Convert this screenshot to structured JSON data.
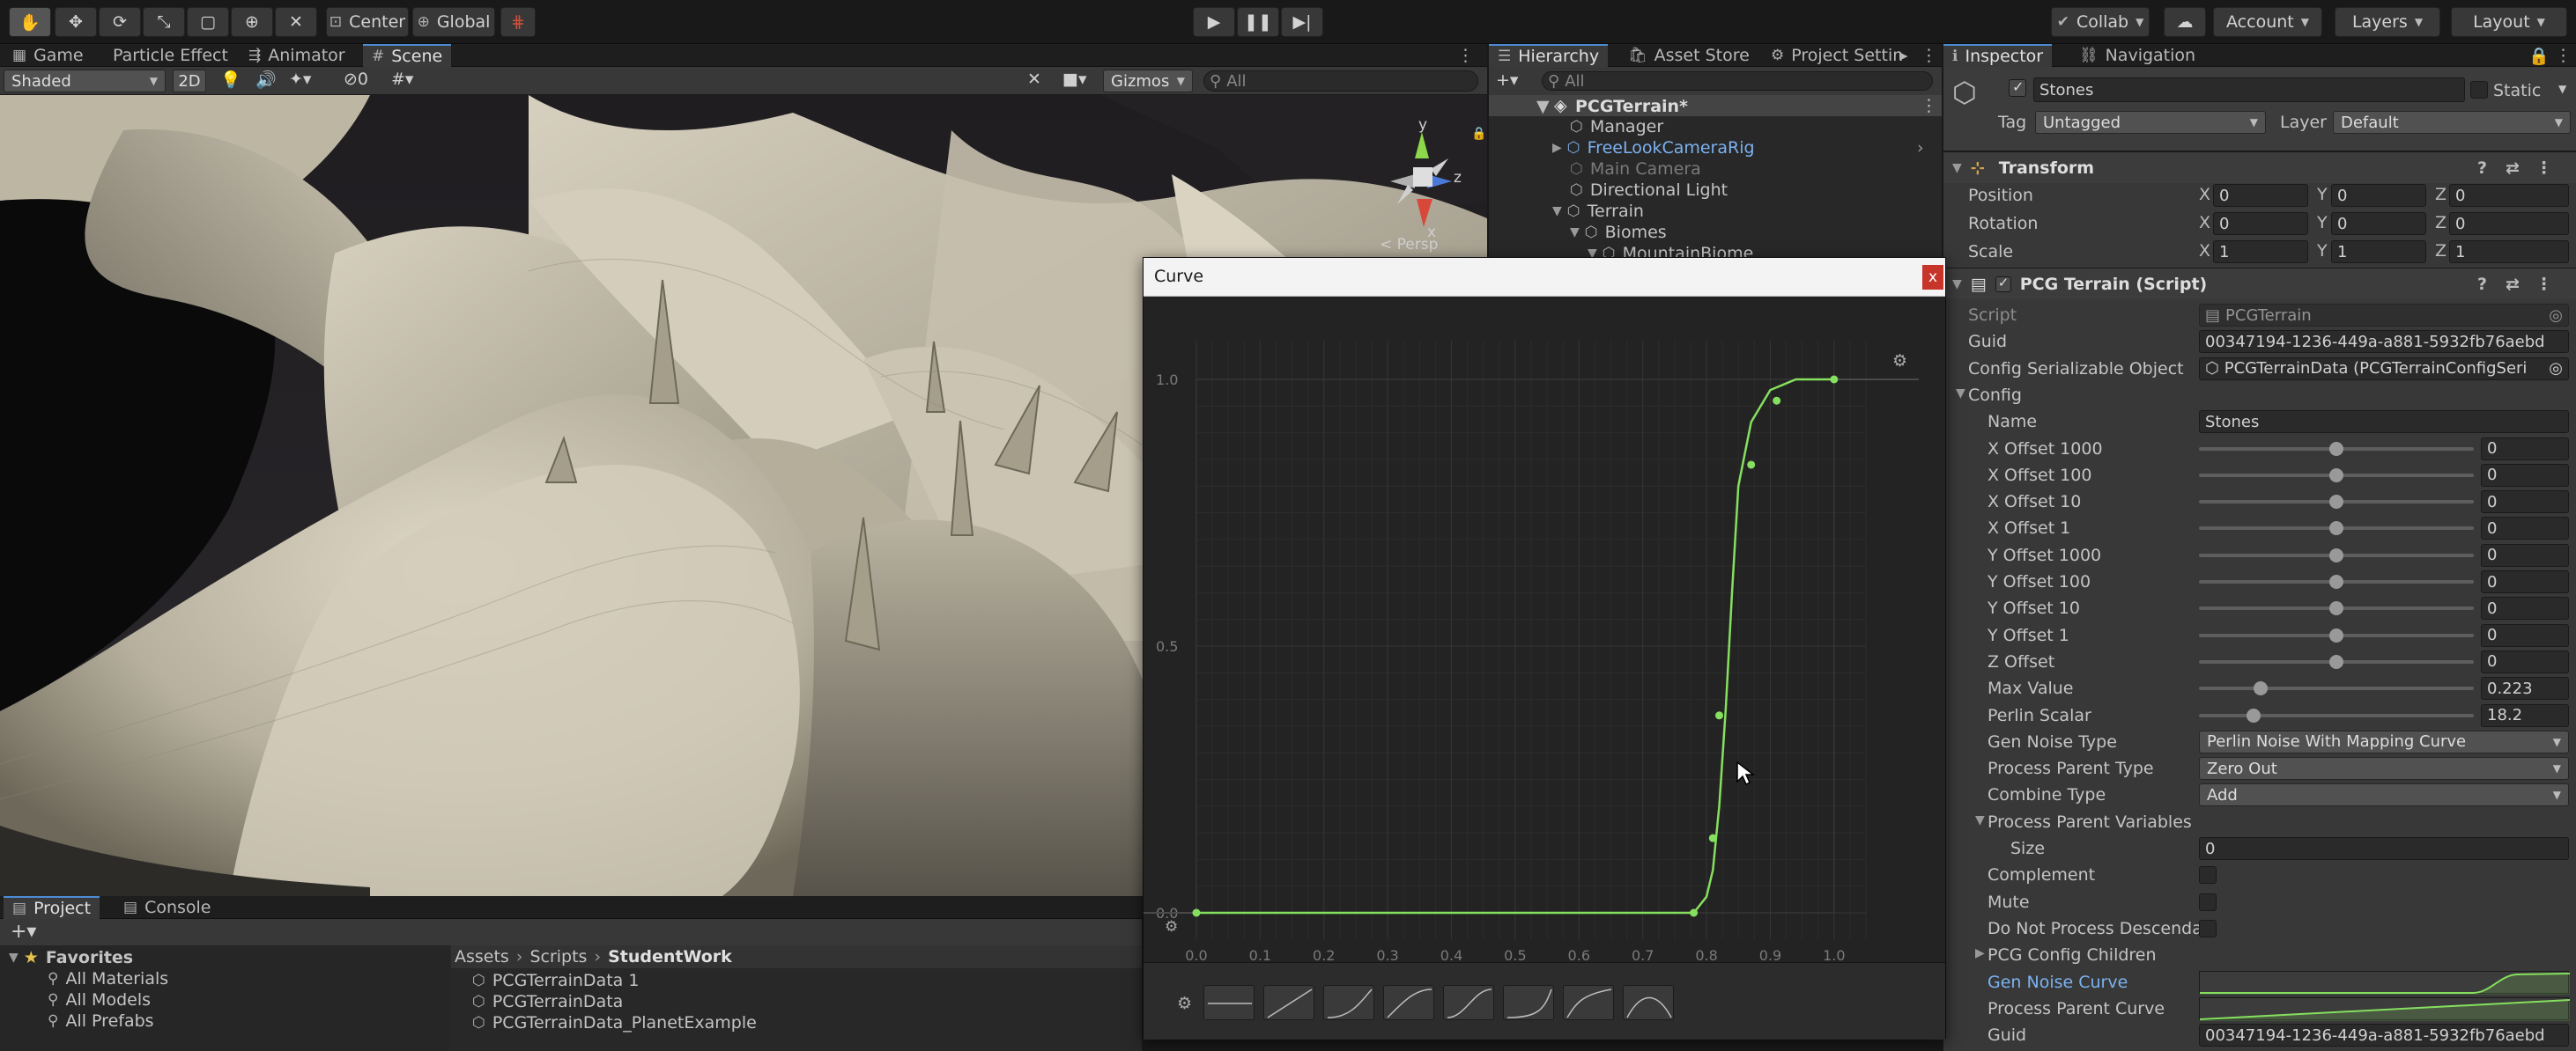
{
  "toolbar": {
    "pivot_label": "Center",
    "space_label": "Global",
    "collab_label": "Collab",
    "account_label": "Account",
    "layers_label": "Layers",
    "layout_label": "Layout"
  },
  "left_tabs": [
    "Game",
    "Particle Effect",
    "Animator",
    "Scene"
  ],
  "scene": {
    "shading_mode": "Shaded",
    "mode_2d": "2D",
    "hidden_count": "0",
    "gizmos_label": "Gizmos",
    "search_placeholder": "All",
    "persp_label": "< Persp",
    "axis_x": "x",
    "axis_y": "y",
    "axis_z": "z"
  },
  "hierarchy": {
    "tabs": [
      "Hierarchy",
      "Asset Store",
      "Project Settin"
    ],
    "search_placeholder": "All",
    "items": [
      {
        "label": "PCGTerrain*",
        "color": "#dcdcdc"
      },
      {
        "label": "Manager",
        "color": "#c4c4c4"
      },
      {
        "label": "FreeLookCameraRig",
        "color": "#7cb2f0"
      },
      {
        "label": "Main Camera",
        "color": "#7a7a7a"
      },
      {
        "label": "Directional Light",
        "color": "#c4c4c4"
      },
      {
        "label": "Terrain",
        "color": "#c4c4c4"
      },
      {
        "label": "Biomes",
        "color": "#c4c4c4"
      },
      {
        "label": "MountainBiome",
        "color": "#c4c4c4"
      }
    ]
  },
  "project": {
    "tabs": [
      "Project",
      "Console"
    ],
    "favorites_label": "Favorites",
    "favorites": [
      "All Materials",
      "All Models",
      "All Prefabs"
    ],
    "breadcrumb": [
      "Assets",
      "Scripts",
      "StudentWork"
    ],
    "files": [
      "PCGTerrainData 1",
      "PCGTerrainData",
      "PCGTerrainData_PlanetExample"
    ]
  },
  "curve_window": {
    "title": "Curve",
    "close_symbol": "x",
    "y_ticks": [
      "1.0",
      "0.5",
      "0.0"
    ],
    "x_ticks": [
      "0.0",
      "0.1",
      "0.2",
      "0.3",
      "0.4",
      "0.5",
      "0.6",
      "0.7",
      "0.8",
      "0.9",
      "1.0"
    ],
    "curve_color": "#86e05f"
  },
  "chart_data": {
    "type": "line",
    "title": "Curve",
    "xlabel": "",
    "ylabel": "",
    "xlim": [
      0.0,
      1.05
    ],
    "ylim": [
      0.0,
      1.0
    ],
    "grid": true,
    "x": [
      0.0,
      0.78,
      0.8,
      0.81,
      0.82,
      0.83,
      0.84,
      0.85,
      0.87,
      0.9,
      0.94,
      0.98,
      1.0
    ],
    "y": [
      0.0,
      0.0,
      0.03,
      0.08,
      0.2,
      0.38,
      0.6,
      0.8,
      0.92,
      0.98,
      1.0,
      1.0,
      1.0
    ],
    "keys": [
      [
        0.0,
        0.0
      ],
      [
        0.78,
        0.0
      ],
      [
        0.81,
        0.14
      ],
      [
        0.82,
        0.37
      ],
      [
        0.87,
        0.84
      ],
      [
        0.91,
        0.96
      ],
      [
        1.0,
        1.0
      ]
    ]
  },
  "inspector": {
    "tabs": [
      "Inspector",
      "Navigation"
    ],
    "object_name": "Stones",
    "static_label": "Static",
    "tag_label": "Tag",
    "tag_value": "Untagged",
    "layer_label": "Layer",
    "layer_value": "Default",
    "transform": {
      "title": "Transform",
      "rows": [
        {
          "label": "Position",
          "x": "0",
          "y": "0",
          "z": "0"
        },
        {
          "label": "Rotation",
          "x": "0",
          "y": "0",
          "z": "0"
        },
        {
          "label": "Scale",
          "x": "1",
          "y": "1",
          "z": "1"
        }
      ]
    },
    "pcg": {
      "title": "PCG Terrain (Script)",
      "script_label": "Script",
      "script_value": "PCGTerrain",
      "guid_label": "Guid",
      "guid_value": "00347194-1236-449a-a881-5932fb76aebd",
      "config_obj_label": "Config Serializable Object",
      "config_obj_value": "PCGTerrainData (PCGTerrainConfigSeri",
      "config_label": "Config",
      "name_label": "Name",
      "name_value": "Stones",
      "sliders": [
        {
          "label": "X Offset 1000",
          "value": "0",
          "level": 0.5
        },
        {
          "label": "X Offset 100",
          "value": "0",
          "level": 0.5
        },
        {
          "label": "X Offset 10",
          "value": "0",
          "level": 0.5
        },
        {
          "label": "X Offset 1",
          "value": "0",
          "level": 0.5
        },
        {
          "label": "Y Offset 1000",
          "value": "0",
          "level": 0.5
        },
        {
          "label": "Y Offset 100",
          "value": "0",
          "level": 0.5
        },
        {
          "label": "Y Offset 10",
          "value": "0",
          "level": 0.5
        },
        {
          "label": "Y Offset 1",
          "value": "0",
          "level": 0.5
        },
        {
          "label": "Z Offset",
          "value": "0",
          "level": 0.5
        },
        {
          "label": "Max Value",
          "value": "0.223",
          "level": 0.223
        },
        {
          "label": "Perlin Scalar",
          "value": "18.2",
          "level": 0.2
        }
      ],
      "dropdowns": [
        {
          "label": "Gen Noise Type",
          "value": "Perlin Noise With Mapping Curve"
        },
        {
          "label": "Process Parent Type",
          "value": "Zero Out"
        },
        {
          "label": "Combine Type",
          "value": "Add"
        }
      ],
      "process_parent_vars_label": "Process Parent Variables",
      "size_label": "Size",
      "size_value": "0",
      "checkboxes": [
        "Complement",
        "Mute",
        "Do Not Process Descendan"
      ],
      "children_label": "PCG Config Children",
      "gen_noise_curve_label": "Gen Noise Curve",
      "process_parent_curve_label": "Process Parent Curve",
      "guid2_label": "Guid",
      "guid2_value": "00347194-1236-449a-a881-5932fb76aebd"
    }
  }
}
